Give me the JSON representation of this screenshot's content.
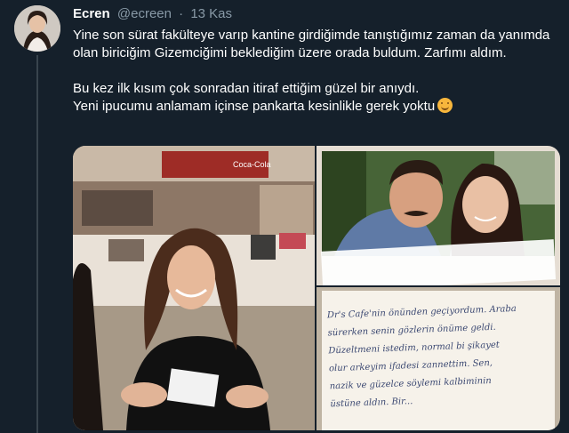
{
  "tweet": {
    "author_name": "Ecren",
    "author_handle": "@ecreen",
    "separator": "·",
    "timestamp": "13 Kas",
    "paragraph_1": "Yine son sürat fakülteye varıp kantine girdiğimde tanıştığımız zaman da yanımda olan biriciğim Gizemciğimi beklediğim üzere orada buldum. Zarfımı aldım.",
    "paragraph_2_line_1": "Bu kez ilk kısım çok sonradan itiraf ettiğim güzel bir anıydı.",
    "paragraph_2_line_2": "Yeni ipucumu anlamam içinse pankarta kesinlikle gerek yoktu",
    "emoji": "smiling-face-with-smiling-eyes"
  },
  "media": {
    "sign_text": "Coca-Cola",
    "note_lines": [
      "Dr's Cafe'nin önünden geçiyordum. Araba",
      "sürerken senin gözlerin önüme geldi.",
      "Düzeltmeni istedim, normal bi şikayet",
      "olur arkeyim ifadesi zannettim. Sen,",
      "nazik ve güzelce söylemi kalbiminin",
      "üstüne aldın. Bir..."
    ]
  }
}
